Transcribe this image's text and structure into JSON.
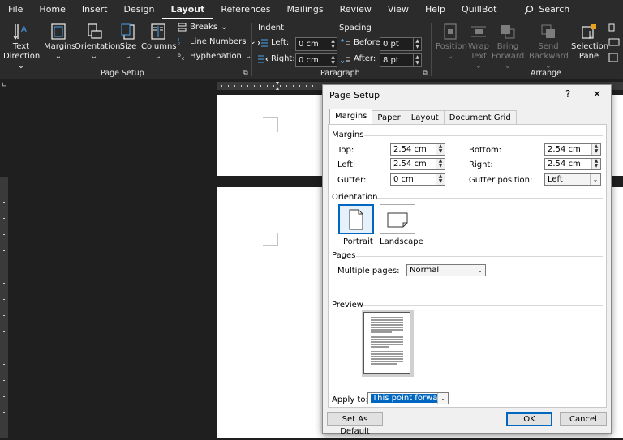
{
  "menubar": {
    "items": [
      "File",
      "Home",
      "Insert",
      "Design",
      "Layout",
      "References",
      "Mailings",
      "Review",
      "View",
      "Help",
      "QuillBot"
    ],
    "active_index": 4,
    "search_label": "Search"
  },
  "ribbon": {
    "page_setup": {
      "group_label": "Page Setup",
      "text_direction": [
        "Text",
        "Direction"
      ],
      "margins": "Margins",
      "orientation": "Orientation",
      "size": "Size",
      "columns": "Columns",
      "breaks": "Breaks",
      "line_numbers": "Line Numbers",
      "hyphenation": "Hyphenation"
    },
    "paragraph": {
      "group_label": "Paragraph",
      "indent_label": "Indent",
      "spacing_label": "Spacing",
      "left_label": "Left:",
      "right_label": "Right:",
      "left_value": "0 cm",
      "right_value": "0 cm",
      "before_label": "Before:",
      "after_label": "After:",
      "before_value": "0 pt",
      "after_value": "8 pt"
    },
    "arrange": {
      "group_label": "Arrange",
      "position": "Position",
      "wrap_text": [
        "Wrap",
        "Text"
      ],
      "bring_forward": [
        "Bring",
        "Forward"
      ],
      "send_backward": [
        "Send",
        "Backward"
      ],
      "selection_pane": [
        "Selection",
        "Pane"
      ]
    }
  },
  "dialog": {
    "title": "Page Setup",
    "help": "?",
    "close": "✕",
    "tabs": [
      "Margins",
      "Paper",
      "Layout",
      "Document Grid"
    ],
    "active_tab": 0,
    "margins_section": "Margins",
    "top_label": "Top:",
    "bottom_label": "Bottom:",
    "left_label": "Left:",
    "right_label": "Right:",
    "gutter_label": "Gutter:",
    "gutter_position_label": "Gutter position:",
    "top_value": "2.54 cm",
    "bottom_value": "2.54 cm",
    "left_value": "2.54 cm",
    "right_value": "2.54 cm",
    "gutter_value": "0 cm",
    "gutter_position_value": "Left",
    "orientation_section": "Orientation",
    "portrait_label": "Portrait",
    "landscape_label": "Landscape",
    "pages_section": "Pages",
    "multiple_pages_label": "Multiple pages:",
    "multiple_pages_value": "Normal",
    "preview_section": "Preview",
    "apply_to_label": "Apply to:",
    "apply_to_value": "This point forward",
    "set_default": "Set As Default",
    "ok": "OK",
    "cancel": "Cancel"
  },
  "colors": {
    "accent": "#0067c0",
    "ribbon_bg": "#2b2b2b",
    "doc_bg": "#1f1f1f"
  }
}
